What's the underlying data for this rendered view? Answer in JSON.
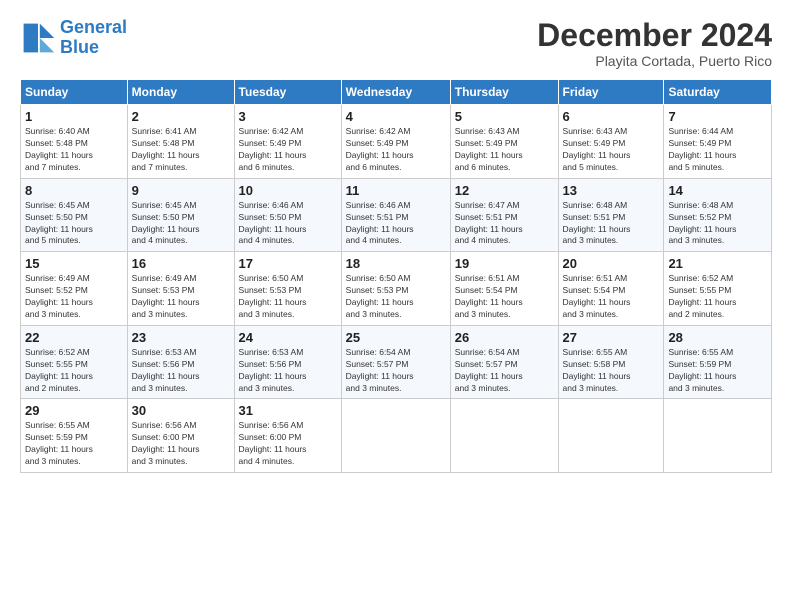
{
  "logo": {
    "line1": "General",
    "line2": "Blue"
  },
  "title": "December 2024",
  "subtitle": "Playita Cortada, Puerto Rico",
  "header": {
    "days": [
      "Sunday",
      "Monday",
      "Tuesday",
      "Wednesday",
      "Thursday",
      "Friday",
      "Saturday"
    ]
  },
  "weeks": [
    [
      {
        "day": "1",
        "info": "Sunrise: 6:40 AM\nSunset: 5:48 PM\nDaylight: 11 hours\nand 7 minutes."
      },
      {
        "day": "2",
        "info": "Sunrise: 6:41 AM\nSunset: 5:48 PM\nDaylight: 11 hours\nand 7 minutes."
      },
      {
        "day": "3",
        "info": "Sunrise: 6:42 AM\nSunset: 5:49 PM\nDaylight: 11 hours\nand 6 minutes."
      },
      {
        "day": "4",
        "info": "Sunrise: 6:42 AM\nSunset: 5:49 PM\nDaylight: 11 hours\nand 6 minutes."
      },
      {
        "day": "5",
        "info": "Sunrise: 6:43 AM\nSunset: 5:49 PM\nDaylight: 11 hours\nand 6 minutes."
      },
      {
        "day": "6",
        "info": "Sunrise: 6:43 AM\nSunset: 5:49 PM\nDaylight: 11 hours\nand 5 minutes."
      },
      {
        "day": "7",
        "info": "Sunrise: 6:44 AM\nSunset: 5:49 PM\nDaylight: 11 hours\nand 5 minutes."
      }
    ],
    [
      {
        "day": "8",
        "info": "Sunrise: 6:45 AM\nSunset: 5:50 PM\nDaylight: 11 hours\nand 5 minutes."
      },
      {
        "day": "9",
        "info": "Sunrise: 6:45 AM\nSunset: 5:50 PM\nDaylight: 11 hours\nand 4 minutes."
      },
      {
        "day": "10",
        "info": "Sunrise: 6:46 AM\nSunset: 5:50 PM\nDaylight: 11 hours\nand 4 minutes."
      },
      {
        "day": "11",
        "info": "Sunrise: 6:46 AM\nSunset: 5:51 PM\nDaylight: 11 hours\nand 4 minutes."
      },
      {
        "day": "12",
        "info": "Sunrise: 6:47 AM\nSunset: 5:51 PM\nDaylight: 11 hours\nand 4 minutes."
      },
      {
        "day": "13",
        "info": "Sunrise: 6:48 AM\nSunset: 5:51 PM\nDaylight: 11 hours\nand 3 minutes."
      },
      {
        "day": "14",
        "info": "Sunrise: 6:48 AM\nSunset: 5:52 PM\nDaylight: 11 hours\nand 3 minutes."
      }
    ],
    [
      {
        "day": "15",
        "info": "Sunrise: 6:49 AM\nSunset: 5:52 PM\nDaylight: 11 hours\nand 3 minutes."
      },
      {
        "day": "16",
        "info": "Sunrise: 6:49 AM\nSunset: 5:53 PM\nDaylight: 11 hours\nand 3 minutes."
      },
      {
        "day": "17",
        "info": "Sunrise: 6:50 AM\nSunset: 5:53 PM\nDaylight: 11 hours\nand 3 minutes."
      },
      {
        "day": "18",
        "info": "Sunrise: 6:50 AM\nSunset: 5:53 PM\nDaylight: 11 hours\nand 3 minutes."
      },
      {
        "day": "19",
        "info": "Sunrise: 6:51 AM\nSunset: 5:54 PM\nDaylight: 11 hours\nand 3 minutes."
      },
      {
        "day": "20",
        "info": "Sunrise: 6:51 AM\nSunset: 5:54 PM\nDaylight: 11 hours\nand 3 minutes."
      },
      {
        "day": "21",
        "info": "Sunrise: 6:52 AM\nSunset: 5:55 PM\nDaylight: 11 hours\nand 2 minutes."
      }
    ],
    [
      {
        "day": "22",
        "info": "Sunrise: 6:52 AM\nSunset: 5:55 PM\nDaylight: 11 hours\nand 2 minutes."
      },
      {
        "day": "23",
        "info": "Sunrise: 6:53 AM\nSunset: 5:56 PM\nDaylight: 11 hours\nand 3 minutes."
      },
      {
        "day": "24",
        "info": "Sunrise: 6:53 AM\nSunset: 5:56 PM\nDaylight: 11 hours\nand 3 minutes."
      },
      {
        "day": "25",
        "info": "Sunrise: 6:54 AM\nSunset: 5:57 PM\nDaylight: 11 hours\nand 3 minutes."
      },
      {
        "day": "26",
        "info": "Sunrise: 6:54 AM\nSunset: 5:57 PM\nDaylight: 11 hours\nand 3 minutes."
      },
      {
        "day": "27",
        "info": "Sunrise: 6:55 AM\nSunset: 5:58 PM\nDaylight: 11 hours\nand 3 minutes."
      },
      {
        "day": "28",
        "info": "Sunrise: 6:55 AM\nSunset: 5:59 PM\nDaylight: 11 hours\nand 3 minutes."
      }
    ],
    [
      {
        "day": "29",
        "info": "Sunrise: 6:55 AM\nSunset: 5:59 PM\nDaylight: 11 hours\nand 3 minutes."
      },
      {
        "day": "30",
        "info": "Sunrise: 6:56 AM\nSunset: 6:00 PM\nDaylight: 11 hours\nand 3 minutes."
      },
      {
        "day": "31",
        "info": "Sunrise: 6:56 AM\nSunset: 6:00 PM\nDaylight: 11 hours\nand 4 minutes."
      },
      null,
      null,
      null,
      null
    ]
  ]
}
